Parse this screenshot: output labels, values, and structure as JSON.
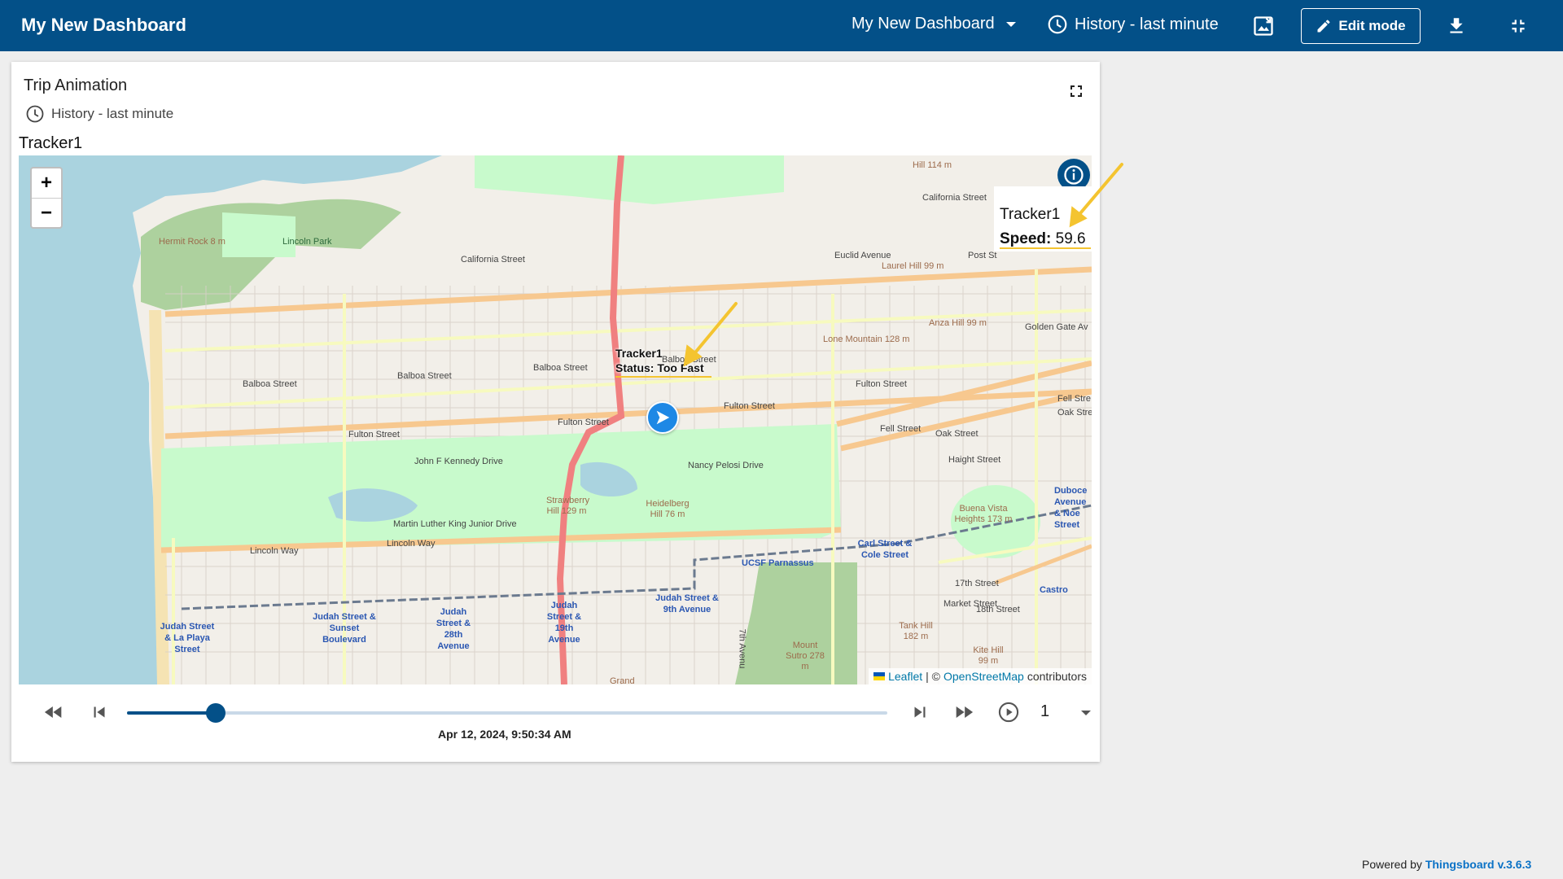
{
  "topbar": {
    "title": "My New Dashboard",
    "dashboard_select": "My New Dashboard",
    "timewindow": "History - last minute",
    "edit_label": "Edit mode",
    "icons": [
      "image-export-icon",
      "download-icon",
      "exit-fullscreen-icon"
    ]
  },
  "widget": {
    "title": "Trip Animation",
    "timewindow": "History - last minute",
    "tracker_label": "Tracker1"
  },
  "map": {
    "zoom_in": "+",
    "zoom_out": "−",
    "marker_label_name": "Tracker1",
    "marker_label_status": "Status: Too Fast",
    "tooltip": {
      "name": "Tracker1",
      "speed_label": "Speed:",
      "speed_value": "59.6"
    },
    "attribution": {
      "leaflet": "Leaflet",
      "sep": "| ©",
      "osm": "OpenStreetMap",
      "suffix": "contributors"
    },
    "labels": {
      "hermit_rock": "Hermit Rock 8 m",
      "lincoln_park": "Lincoln Park",
      "california_st_1": "California Street",
      "california_st_2": "California Street",
      "euclid": "Euclid Avenue",
      "laurel_hill": "Laurel Hill 99 m",
      "post_st": "Post St",
      "golden_gate": "Golden Gate Av",
      "anza_hill": "Anza Hill 99 m",
      "lone_mountain": "Lone Mountain 128 m",
      "hill_114": "Hill 114 m",
      "balboa_1": "Balboa Street",
      "balboa_2": "Balboa Street",
      "balboa_3": "Balboa Street",
      "balboa_4": "Balboa Street",
      "fulton_1": "Fulton Street",
      "fulton_2": "Fulton Street",
      "fulton_3": "Fulton Street",
      "fulton_4": "Fulton Street",
      "fell_1": "Fell Street",
      "fell_2": "Fell Stre",
      "oak_1": "Oak Street",
      "oak_2": "Oak Stre",
      "haight": "Haight Street",
      "jfk": "John F Kennedy Drive",
      "nancy_pelosi": "Nancy Pelosi Drive",
      "mlk": "Martin Luther King Junior Drive",
      "lincoln_way_1": "Lincoln Way",
      "lincoln_way_2": "Lincoln Way",
      "strawberry": "Strawberry Hill 129 m",
      "heidelberg": "Heidelberg Hill 76 m",
      "carl_cole": "Carl Street & Cole Street",
      "ucsf": "UCSF Parnassus",
      "duboce": "Duboce Avenue & Noe Street",
      "buena_vista": "Buena Vista Heights 173 m",
      "st17": "17th Street",
      "castro": "Castro",
      "market": "Market Street",
      "st18": "18th Street",
      "tank_hill": "Tank Hill 182 m",
      "kite_hill": "Kite Hill 99 m",
      "mount_sutro": "Mount Sutro 278 m",
      "judah_la_playa": "Judah Street & La Playa Street",
      "judah_sunset": "Judah Street & Sunset Boulevard",
      "judah_28th": "Judah Street & 28th Avenue",
      "judah_19th": "Judah Street & 19th Avenue",
      "judah_9th": "Judah Street & 9th Avenue",
      "seventh_ave": "7th Avenu",
      "grand": "Grand"
    }
  },
  "playback": {
    "progress": 0.117,
    "timestamp": "Apr 12, 2024, 9:50:34 AM",
    "speed": "1"
  },
  "footer": {
    "prefix": "Powered by",
    "link": "Thingsboard v.3.6.3"
  },
  "colors": {
    "primary": "#035088",
    "marker": "#1e88e5",
    "annotation": "#f4c430",
    "water": "#aad3df",
    "park": "#c8facc",
    "major_road": "#f7c88f",
    "highway": "#f08080"
  }
}
